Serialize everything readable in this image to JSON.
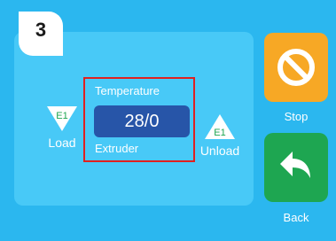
{
  "step": {
    "number": "3"
  },
  "load": {
    "extruder_tag": "E1",
    "label": "Load"
  },
  "unload": {
    "extruder_tag": "E1",
    "label": "Unload"
  },
  "temperature": {
    "title": "Temperature",
    "value": "28/0",
    "source": "Extruder"
  },
  "actions": {
    "stop_label": "Stop",
    "back_label": "Back"
  },
  "colors": {
    "background": "#2bb7ef",
    "panel": "#48c9f7",
    "value_box": "#2755a8",
    "highlight": "#e02020",
    "stop": "#f7a825",
    "back": "#1ea651",
    "text": "#ffffff"
  },
  "icons": {
    "load": "down-triangle-icon",
    "unload": "up-triangle-icon",
    "stop": "no-entry-icon",
    "back": "back-arrow-icon"
  }
}
